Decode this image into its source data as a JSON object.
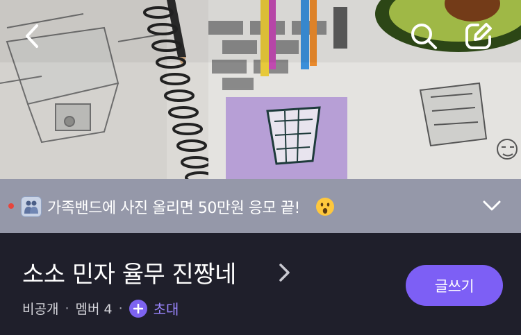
{
  "header": {
    "back_icon": "chevron-left-icon",
    "search_icon": "search-icon",
    "write_icon": "edit-icon"
  },
  "notice": {
    "text": "가족밴드에 사진 올리면 50만원 응모 끝!",
    "leading_icon": "family-icon",
    "trailing_emoji": "surprised-face-emoji",
    "dot_color": "#e8453c"
  },
  "band": {
    "name": "소소 민자 율무 진짱네",
    "visibility": "비공개",
    "members_label": "멤버 4",
    "separator": "·",
    "invite_label": "초대",
    "post_button_label": "글쓰기",
    "accent_color": "#7d5ff5"
  }
}
